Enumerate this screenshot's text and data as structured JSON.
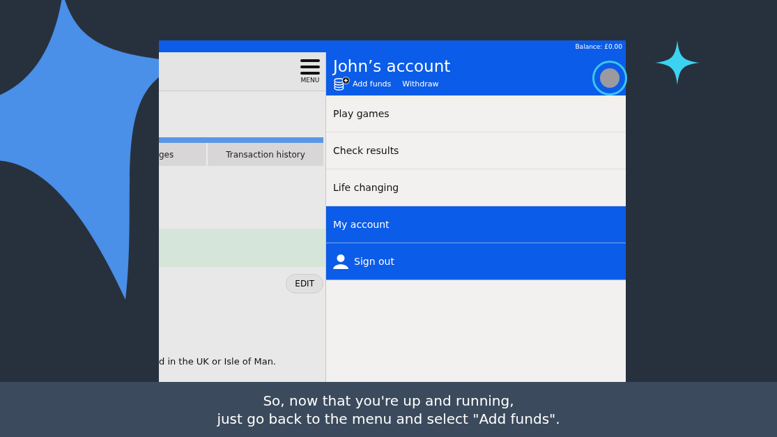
{
  "top_bar": {
    "balance": "Balance: £0.00"
  },
  "left_panel": {
    "menu_label": "MENU",
    "tabs": [
      {
        "label": "ges"
      },
      {
        "label": "Transaction history"
      }
    ],
    "edit_button": "EDIT",
    "footer_text": "d in the UK or Isle of Man."
  },
  "account_menu": {
    "title": "John’s account",
    "links": [
      "Add funds",
      "Withdraw"
    ],
    "items": [
      {
        "label": "Play games",
        "kind": "link",
        "selected": false
      },
      {
        "label": "Check results",
        "kind": "link",
        "selected": false
      },
      {
        "label": "Life changing",
        "kind": "link",
        "selected": false
      },
      {
        "label": "My account",
        "kind": "link",
        "selected": true
      }
    ],
    "sign_out": "Sign out"
  },
  "caption": [
    "So, now that you're up and running,",
    "just go back to the menu and select \"Add funds\"."
  ]
}
